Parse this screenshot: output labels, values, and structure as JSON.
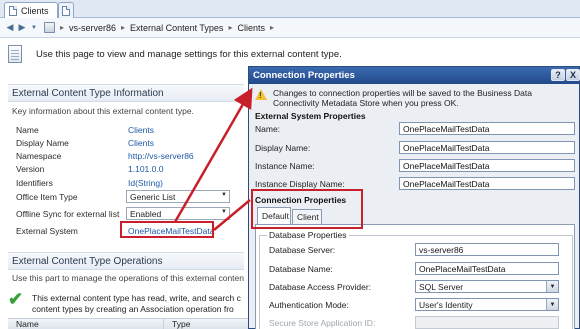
{
  "browser": {
    "tab_title": "Clients",
    "breadcrumb": [
      "vs-server86",
      "External Content Types",
      "Clients"
    ]
  },
  "page": {
    "description": "Use this page to view and manage settings for this external content type."
  },
  "info_section": {
    "title": "External Content Type Information",
    "subtitle": "Key information about this external content type.",
    "rows": [
      {
        "label": "Name",
        "value": "Clients"
      },
      {
        "label": "Display Name",
        "value": "Clients"
      },
      {
        "label": "Namespace",
        "value": "http://vs-server86"
      },
      {
        "label": "Version",
        "value": "1.101.0.0"
      },
      {
        "label": "Identifiers",
        "value": "Id(String)"
      },
      {
        "label": "Office Item Type",
        "value": "Generic List"
      },
      {
        "label": "Offline Sync for external list",
        "value": "Enabled"
      },
      {
        "label": "External System",
        "value": "OnePlaceMailTestData"
      }
    ]
  },
  "ops_section": {
    "title": "External Content Type Operations",
    "subtitle": "Use this part to manage the operations of this external content",
    "text_line1": "This external content type has read, write, and search c",
    "text_line2": "content types by creating an Association operation fro",
    "columns": [
      "Name",
      "Type"
    ]
  },
  "dialog": {
    "title": "Connection Properties",
    "help_btn": "?",
    "close_btn": "X",
    "warning": "Changes to connection properties will be saved to the Business Data Connectivity Metadata Store when you press OK.",
    "system_section": "External System Properties",
    "fields": [
      {
        "label": "Name:",
        "value": "OnePlaceMailTestData"
      },
      {
        "label": "Display Name:",
        "value": "OnePlaceMailTestData"
      },
      {
        "label": "Instance Name:",
        "value": "OnePlaceMailTestData"
      },
      {
        "label": "Instance Display Name:",
        "value": "OnePlaceMailTestData"
      }
    ],
    "connection_section": "Connection Properties",
    "tabs": [
      "Default",
      "Client"
    ],
    "group_title": "Database Properties",
    "db_fields": [
      {
        "label": "Database Server:",
        "value": "vs-server86"
      },
      {
        "label": "Database Name:",
        "value": "OnePlaceMailTestData"
      },
      {
        "label": "Database Access Provider:",
        "value": "SQL Server"
      },
      {
        "label": "Authentication Mode:",
        "value": "User's Identity"
      },
      {
        "label": "Secure Store Application ID:",
        "value": ""
      }
    ]
  },
  "colors": {
    "annotation_red": "#c8202a",
    "link_blue": "#1e5aa6",
    "title_bar": "#2a58a0"
  }
}
